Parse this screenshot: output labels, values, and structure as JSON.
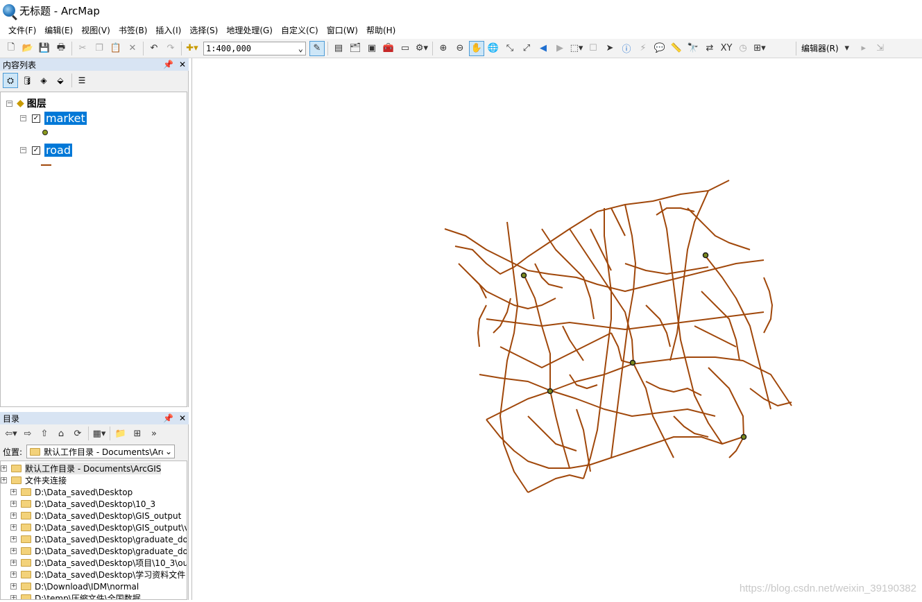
{
  "window": {
    "title": "无标题 - ArcMap"
  },
  "menu": [
    "文件(F)",
    "编辑(E)",
    "视图(V)",
    "书签(B)",
    "插入(I)",
    "选择(S)",
    "地理处理(G)",
    "自定义(C)",
    "窗口(W)",
    "帮助(H)"
  ],
  "toolbar": {
    "scale": "1:400,000",
    "editor_label": "编辑器(R)"
  },
  "toc": {
    "title": "内容列表",
    "group": "图层",
    "layers": [
      {
        "name": "market",
        "checked": true,
        "symbol": "point"
      },
      {
        "name": "road",
        "checked": true,
        "symbol": "line"
      }
    ]
  },
  "catalog": {
    "title": "目录",
    "location_label": "位置:",
    "location_value": "默认工作目录 - Documents\\ArcGIS",
    "items": [
      {
        "label": "默认工作目录 - Documents\\ArcGIS",
        "indent": 0,
        "highlight": true
      },
      {
        "label": "文件夹连接",
        "indent": 0
      },
      {
        "label": "D:\\Data_saved\\Desktop",
        "indent": 1
      },
      {
        "label": "D:\\Data_saved\\Desktop\\10_3",
        "indent": 1
      },
      {
        "label": "D:\\Data_saved\\Desktop\\GIS_output",
        "indent": 1
      },
      {
        "label": "D:\\Data_saved\\Desktop\\GIS_output\\v",
        "indent": 1
      },
      {
        "label": "D:\\Data_saved\\Desktop\\graduate_do",
        "indent": 1
      },
      {
        "label": "D:\\Data_saved\\Desktop\\graduate_do",
        "indent": 1
      },
      {
        "label": "D:\\Data_saved\\Desktop\\项目\\10_3\\ou",
        "indent": 1
      },
      {
        "label": "D:\\Data_saved\\Desktop\\学习资料文件",
        "indent": 1
      },
      {
        "label": "D:\\Download\\IDM\\normal",
        "indent": 1
      },
      {
        "label": "D:\\temp\\压缩文件\\全国数据",
        "indent": 1
      }
    ]
  },
  "map": {
    "road_color": "#a0470a",
    "market_color": "#7c8a1e"
  },
  "watermark": "https://blog.csdn.net/weixin_39190382"
}
